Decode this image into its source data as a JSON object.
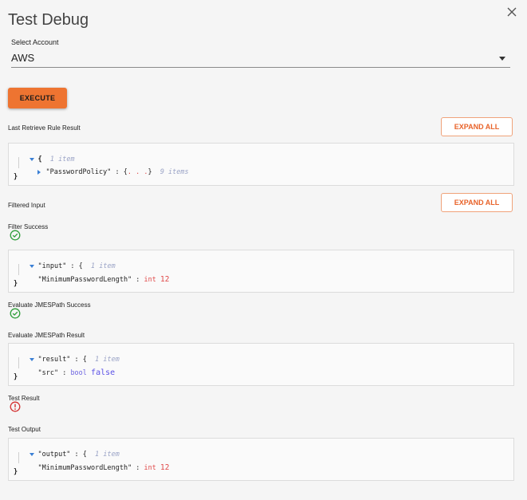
{
  "dialog": {
    "title": "Test Debug",
    "close_icon": "close-icon"
  },
  "account": {
    "label": "Select Account",
    "selected": "AWS"
  },
  "execute_label": "EXECUTE",
  "expand_all_label": "EXPAND ALL",
  "sections": {
    "retrieve": {
      "label": "Last Retrieve Rule Result",
      "open_brace": "{",
      "count": "1 item",
      "key": "\"PasswordPolicy\" : {",
      "dots": ". . .",
      "close_inline": "}",
      "inner_count": "9 items",
      "close_brace": "}"
    },
    "filtered": {
      "label": "Filtered Input",
      "status_label": "Filter Success",
      "key": "\"input\" : {",
      "count": "1 item",
      "child_key": "\"MinimumPasswordLength\" : ",
      "child_type": "int",
      "child_value": "12",
      "close_brace": "}"
    },
    "jmes_eval": {
      "label": "Evaluate JMESPath Success"
    },
    "jmes_result": {
      "label": "Evaluate JMESPath Result",
      "key": "\"result\" : {",
      "count": "1 item",
      "child_key": "\"src\" : ",
      "child_type": "bool",
      "child_value": "false",
      "close_brace": "}"
    },
    "test_result": {
      "label": "Test Result"
    },
    "test_output": {
      "label": "Test Output",
      "key": "\"output\" : {",
      "count": "1 item",
      "child_key": "\"MinimumPasswordLength\" : ",
      "child_type": "int",
      "child_value": "12",
      "close_brace": "}"
    }
  },
  "colors": {
    "accent": "#ee7431",
    "success": "#2e9e3a",
    "error": "#d33030",
    "expand_text": "#e8632a"
  }
}
